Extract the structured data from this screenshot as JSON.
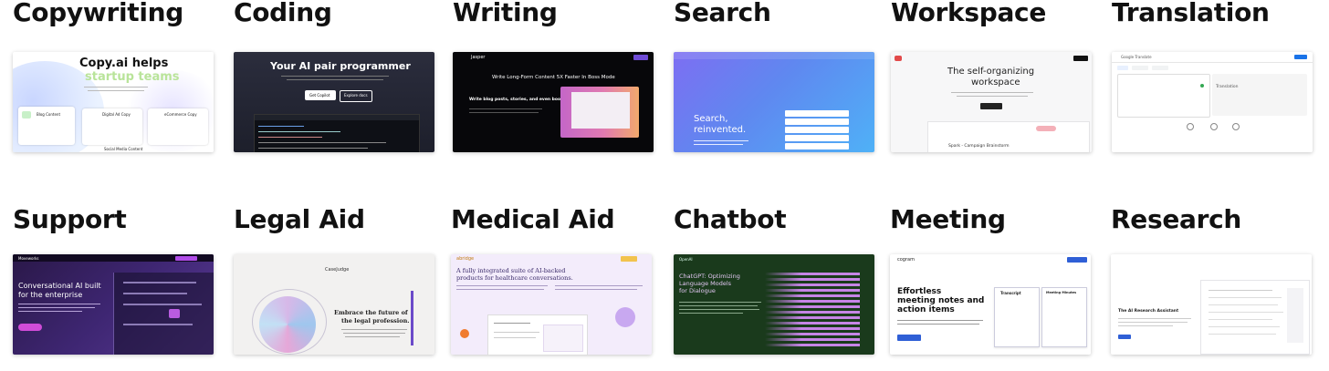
{
  "row1": [
    {
      "title": "Copywriting",
      "headline": "Copy.ai helps",
      "headline2": "startup teams",
      "cards": [
        "Blog Content",
        "Digital Ad Copy",
        "eCommerce Copy"
      ],
      "card4": "Social Media Content"
    },
    {
      "title": "Coding",
      "headline": "Your AI pair programmer",
      "btn1": "Get Copilot",
      "btn2": "Explore docs"
    },
    {
      "title": "Writing",
      "brand": "Jasper",
      "headline": "Write Long-Form Content 5X Faster In Boss Mode",
      "body": "Write blog posts, stories, and even books with"
    },
    {
      "title": "Search",
      "headline": "Search,",
      "headline2": "reinvented."
    },
    {
      "title": "Workspace",
      "headline": "The self-organizing",
      "headline2": "workspace",
      "sub": "Spark - Campaign Brainstorm"
    },
    {
      "title": "Translation",
      "app": "Google Translate",
      "label": "Translation"
    }
  ],
  "row2": [
    {
      "title": "Support",
      "brand": "Moveworks",
      "headline": "Conversational AI built",
      "headline2": "for the enterprise"
    },
    {
      "title": "Legal Aid",
      "brand": "CaseJudge",
      "headline": "Embrace the future of",
      "headline2": "the legal profession."
    },
    {
      "title": "Medical Aid",
      "brand": "abridge",
      "headline": "A fully integrated suite of AI-backed",
      "headline2": "products for healthcare conversations."
    },
    {
      "title": "Chatbot",
      "brand": "OpenAI",
      "headline": "ChatGPT: Optimizing",
      "headline2": "Language Models",
      "headline3": "for Dialogue"
    },
    {
      "title": "Meeting",
      "brand": "cogram",
      "headline": "Effortless",
      "headline2": "meeting notes and",
      "headline3": "action items",
      "panel1": "Transcript",
      "panel2": "Meeting Minutes"
    },
    {
      "title": "Research",
      "headline": "The AI Research Assistant"
    }
  ]
}
